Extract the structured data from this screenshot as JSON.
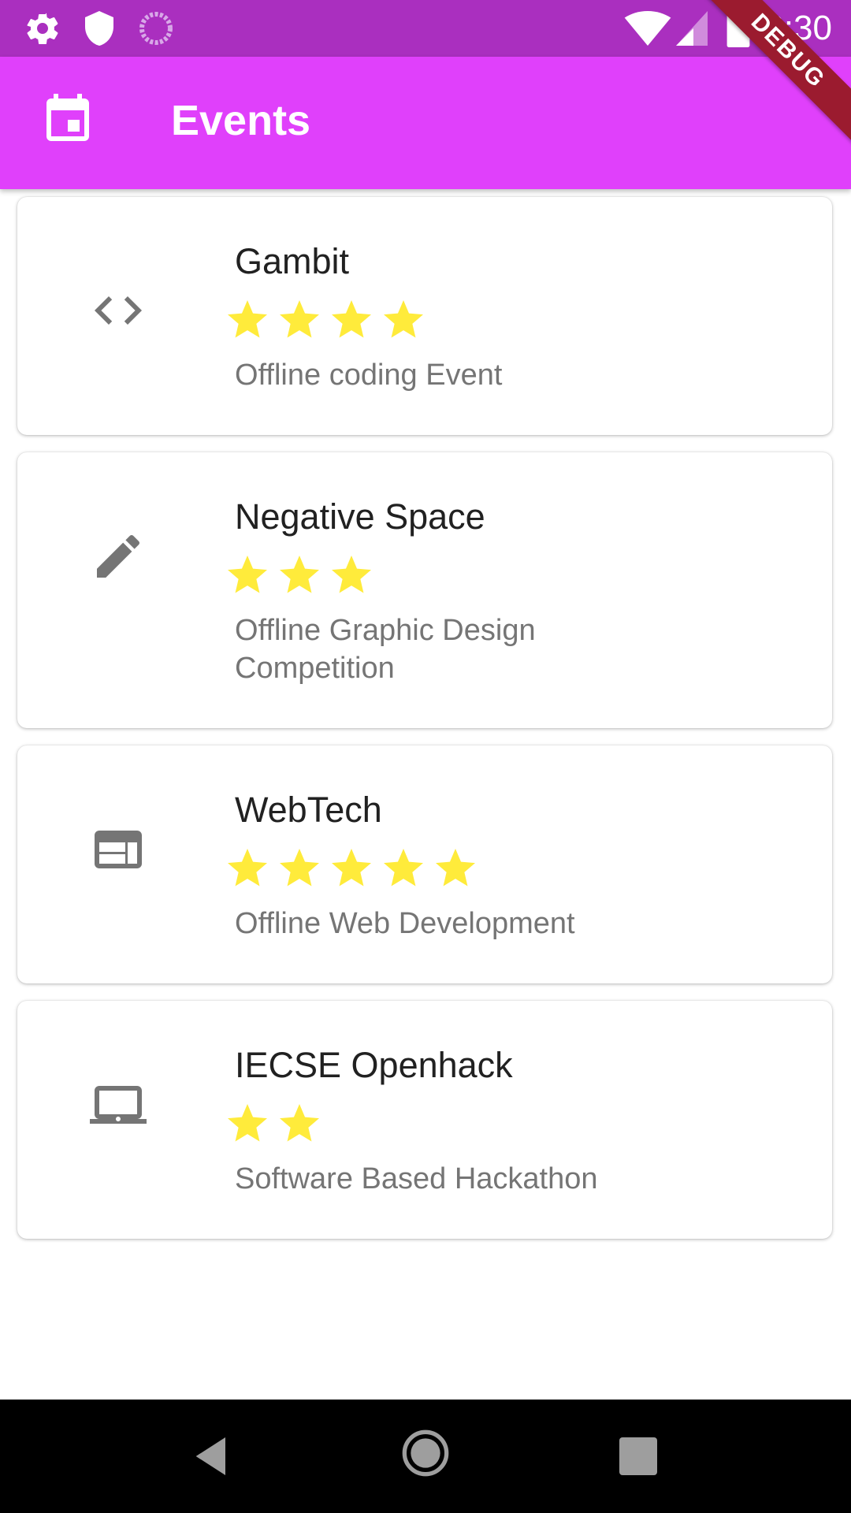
{
  "status_bar": {
    "time": "2:30",
    "left_icons": [
      "gear-icon",
      "shield-icon",
      "loading-icon"
    ],
    "right_icons": [
      "wifi-icon",
      "signal-icon",
      "battery-icon"
    ]
  },
  "app_bar": {
    "icon": "calendar-icon",
    "title": "Events",
    "background": "#e040fb"
  },
  "debug_banner": "DEBUG",
  "events": [
    {
      "icon": "code-icon",
      "title": "Gambit",
      "rating": 4,
      "description": "Offline coding Event"
    },
    {
      "icon": "pencil-icon",
      "title": "Negative Space",
      "rating": 3,
      "description": "Offline Graphic Design Competition"
    },
    {
      "icon": "web-icon",
      "title": "WebTech",
      "rating": 5,
      "description": "Offline Web Development"
    },
    {
      "icon": "laptop-icon",
      "title": "IECSE Openhack",
      "rating": 2,
      "description": "Software Based Hackathon"
    }
  ],
  "colors": {
    "status_bar": "#aa2fbf",
    "star": "#ffeb3b",
    "icon": "#757575"
  },
  "nav_bar": [
    "back-icon",
    "home-icon",
    "recents-icon"
  ]
}
